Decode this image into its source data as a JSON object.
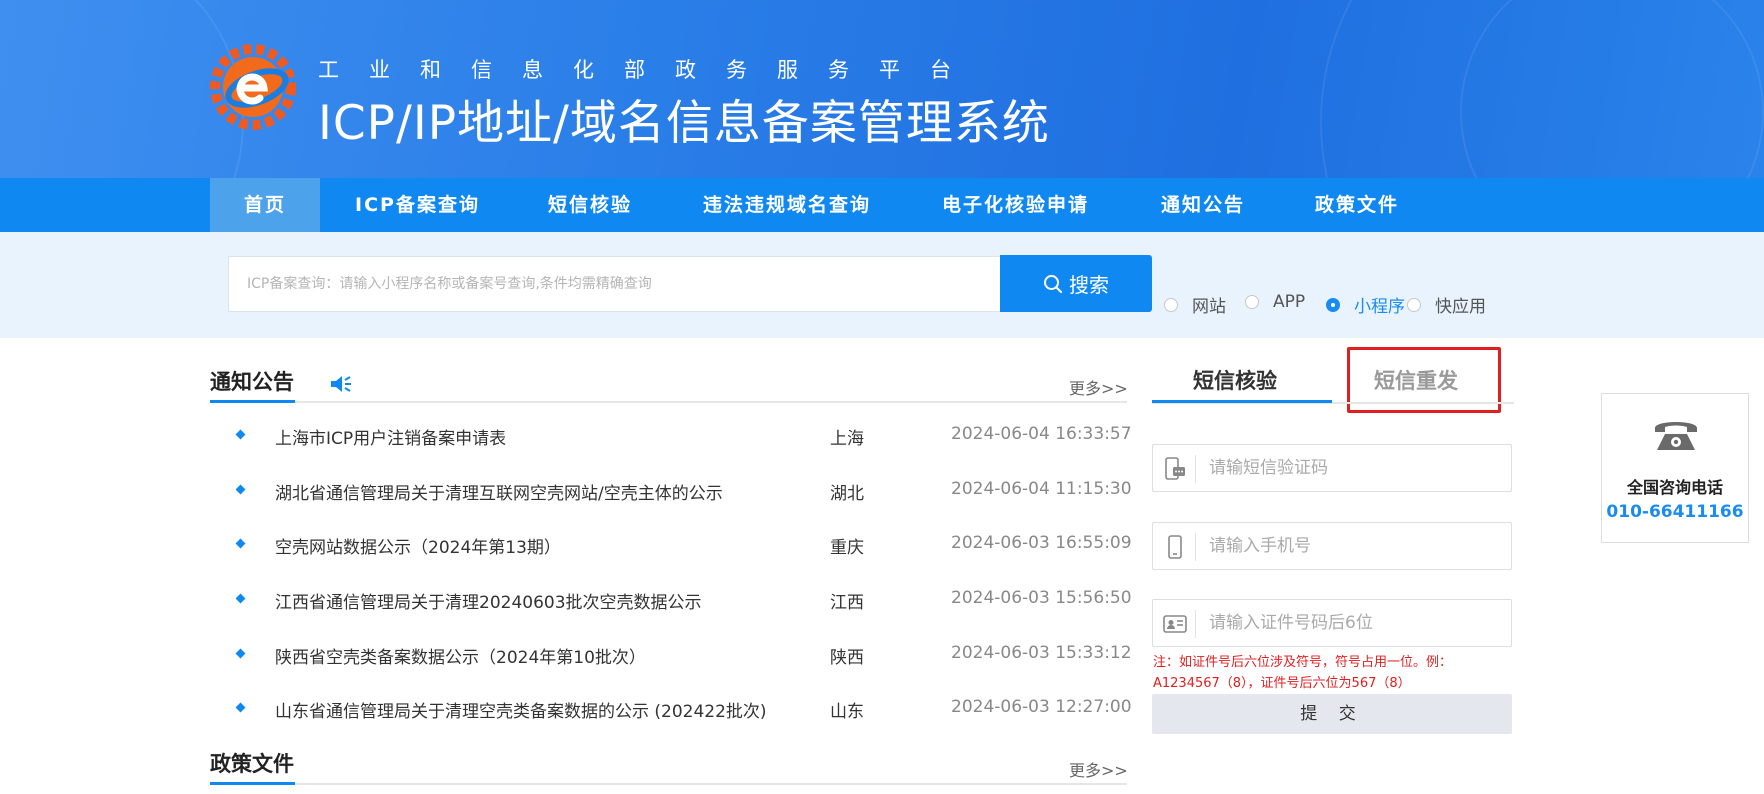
{
  "header": {
    "subtitle": "工业和信息化部政务服务平台",
    "title": "ICP/IP地址/域名信息备案管理系统"
  },
  "nav": {
    "items": [
      {
        "label": "首页",
        "active": true
      },
      {
        "label": "ICP备案查询"
      },
      {
        "label": "短信核验"
      },
      {
        "label": "违法违规域名查询"
      },
      {
        "label": "电子化核验申请"
      },
      {
        "label": "通知公告"
      },
      {
        "label": "政策文件"
      }
    ]
  },
  "search": {
    "placeholder": "ICP备案查询：请输入小程序名称或备案号查询,条件均需精确查询",
    "button_label": "搜索",
    "options": [
      {
        "label": "网站",
        "selected": false
      },
      {
        "label": "APP",
        "selected": false
      },
      {
        "label": "小程序",
        "selected": true
      },
      {
        "label": "快应用",
        "selected": false
      }
    ]
  },
  "notices": {
    "title": "通知公告",
    "more_label": "更多>>",
    "items": [
      {
        "title": "上海市ICP用户注销备案申请表",
        "region": "上海",
        "date": "2024-06-04 16:33:57"
      },
      {
        "title": "湖北省通信管理局关于清理互联网空壳网站/空壳主体的公示",
        "region": "湖北",
        "date": "2024-06-04 11:15:30"
      },
      {
        "title": "空壳网站数据公示（2024年第13期）",
        "region": "重庆",
        "date": "2024-06-03 16:55:09"
      },
      {
        "title": "江西省通信管理局关于清理20240603批次空壳数据公示",
        "region": "江西",
        "date": "2024-06-03 15:56:50"
      },
      {
        "title": "陕西省空壳类备案数据公示（2024年第10批次）",
        "region": "陕西",
        "date": "2024-06-03 15:33:12"
      },
      {
        "title": "山东省通信管理局关于清理空壳类备案数据的公示 (202422批次)",
        "region": "山东",
        "date": "2024-06-03 12:27:00"
      }
    ]
  },
  "policy": {
    "title": "政策文件",
    "more_label": "更多>>"
  },
  "sms": {
    "tabs": [
      {
        "label": "短信核验",
        "active": true
      },
      {
        "label": "短信重发",
        "active": false
      }
    ],
    "fields": {
      "code_placeholder": "请输短信验证码",
      "phone_placeholder": "请输入手机号",
      "id_placeholder": "请输入证件号码后6位"
    },
    "note": "注：如证件号后六位涉及符号，符号占用一位。例：A1234567（8），证件号后六位为567（8）",
    "submit_label": "提 交"
  },
  "hotline": {
    "label": "全国咨询电话",
    "number": "010-66411166"
  },
  "colors": {
    "primary": "#1088f2",
    "nav_active": "#4da2ec",
    "alert": "#e02020"
  }
}
